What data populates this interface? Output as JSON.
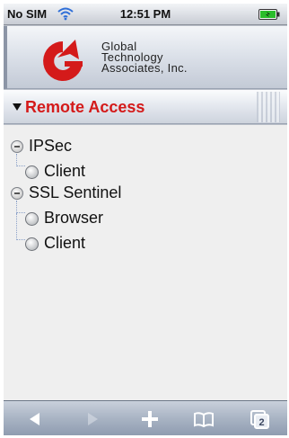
{
  "status_bar": {
    "carrier": "No SIM",
    "time": "12:51 PM"
  },
  "header": {
    "company_lines": [
      "Global",
      "Technology",
      "Associates, Inc."
    ],
    "brand_color": "#d41a1a"
  },
  "section": {
    "title": "Remote Access",
    "arrow_icon": "triangle-down-icon"
  },
  "tree": {
    "ipsec": {
      "label": "IPSec",
      "children": [
        "Client"
      ]
    },
    "ssl": {
      "label": "SSL Sentinel",
      "children": [
        "Browser",
        "Client"
      ]
    }
  },
  "toolbar": {
    "buttons": [
      "back-icon",
      "forward-icon",
      "add-icon",
      "bookmarks-icon",
      "pages-icon"
    ],
    "pages_count": "2"
  }
}
